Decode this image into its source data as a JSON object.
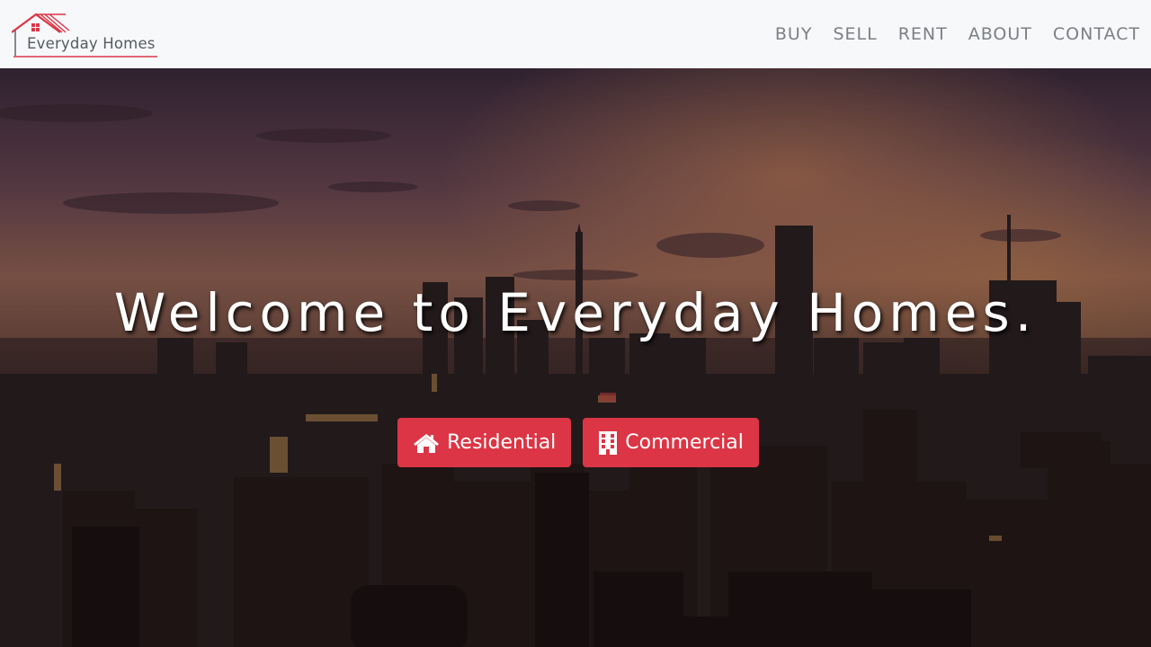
{
  "brand": {
    "name": "Everyday Homes",
    "logo_icon": "house-roof-icon",
    "accent_color": "#dc3545"
  },
  "nav": {
    "items": [
      {
        "label": "BUY"
      },
      {
        "label": "SELL"
      },
      {
        "label": "RENT"
      },
      {
        "label": "ABOUT"
      },
      {
        "label": "CONTACT"
      }
    ]
  },
  "hero": {
    "title": "Welcome to Everyday Homes.",
    "background_image": "city-skyline-sunset",
    "buttons": {
      "residential": {
        "label": "Residential",
        "icon": "home-icon"
      },
      "commercial": {
        "label": "Commercial",
        "icon": "building-icon"
      }
    },
    "button_color": "#dc3545"
  }
}
